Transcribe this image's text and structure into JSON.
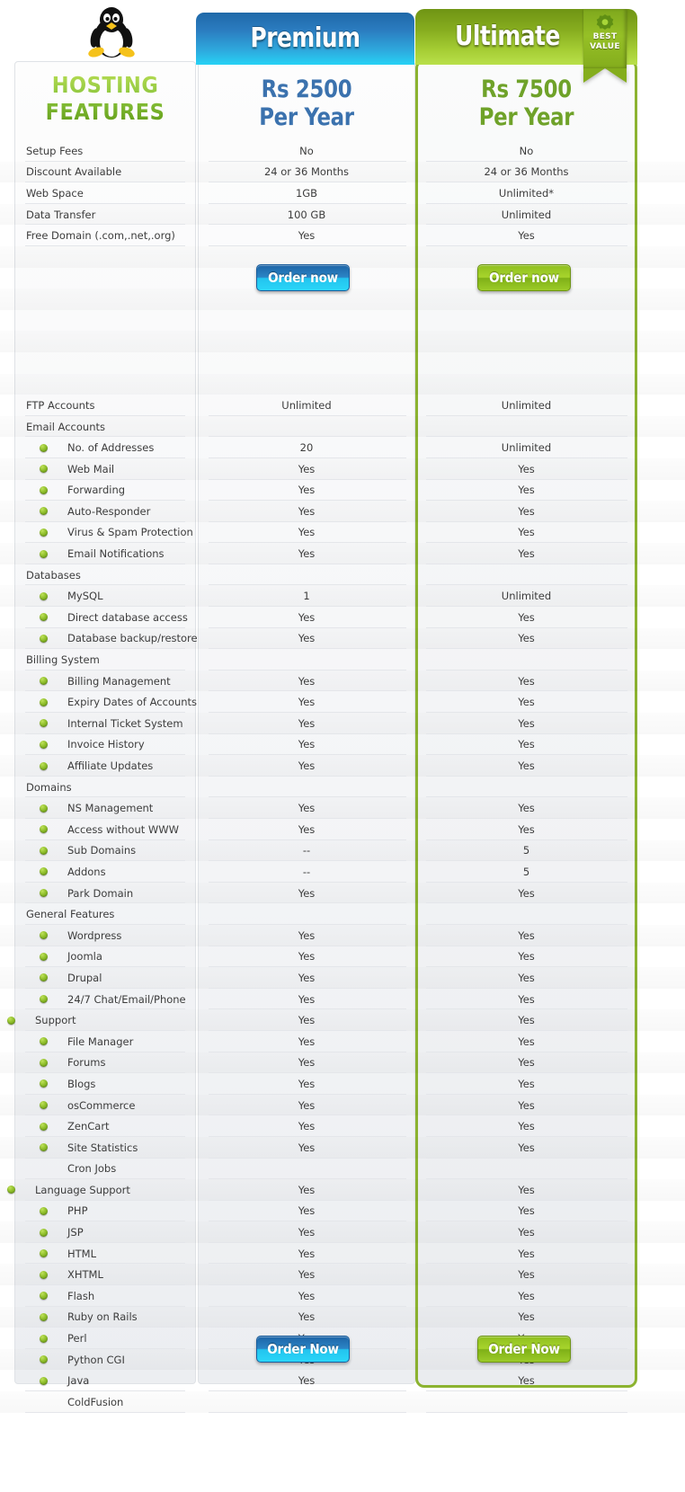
{
  "logo": {
    "name": "linux-tux-logo"
  },
  "features_heading": {
    "line1": "HOSTING",
    "line2": "FEATURES"
  },
  "plans": {
    "premium": {
      "tab_label": "Premium",
      "price_line1": "Rs 2500",
      "price_line2": "Per Year",
      "order_top_label": "Order now",
      "order_bottom_label": "Order Now",
      "accent": "#2b85c6"
    },
    "ultimate": {
      "tab_label": "Ultimate",
      "price_line1": "Rs 7500",
      "price_line2": "Per Year",
      "order_top_label": "Order now",
      "order_bottom_label": "Order Now",
      "accent": "#8cb330",
      "badge_line1": "BEST",
      "badge_line2": "VALUE"
    }
  },
  "rows": [
    {
      "label": "Setup Fees",
      "level": 0,
      "bullet": false,
      "premium": "No",
      "ultimate": "No"
    },
    {
      "label": "Discount Available",
      "level": 0,
      "bullet": false,
      "premium": "24 or 36 Months",
      "ultimate": "24 or 36 Months"
    },
    {
      "label": "Web Space",
      "level": 0,
      "bullet": false,
      "premium": "1GB",
      "ultimate": "Unlimited*"
    },
    {
      "label": "Data Transfer",
      "level": 0,
      "bullet": false,
      "premium": "100 GB",
      "ultimate": "Unlimited"
    },
    {
      "label": "Free Domain (.com,.net,.org)",
      "level": 0,
      "bullet": false,
      "premium": "Yes",
      "ultimate": "Yes"
    },
    {
      "label": "",
      "level": 0,
      "bullet": false,
      "premium": "",
      "ultimate": "",
      "spacer": true
    },
    {
      "label": "",
      "level": 0,
      "bullet": false,
      "premium": "",
      "ultimate": "",
      "spacer": true
    },
    {
      "label": "",
      "level": 0,
      "bullet": false,
      "premium": "",
      "ultimate": "",
      "spacer": true
    },
    {
      "label": "",
      "level": 0,
      "bullet": false,
      "premium": "",
      "ultimate": "",
      "spacer": true
    },
    {
      "label": "",
      "level": 0,
      "bullet": false,
      "premium": "",
      "ultimate": "",
      "spacer": true
    },
    {
      "label": "",
      "level": 0,
      "bullet": false,
      "premium": "",
      "ultimate": "",
      "spacer": true
    },
    {
      "label": "",
      "level": 0,
      "bullet": false,
      "premium": "",
      "ultimate": "",
      "spacer": true
    },
    {
      "label": "FTP Accounts",
      "level": 0,
      "bullet": false,
      "premium": "Unlimited",
      "ultimate": "Unlimited"
    },
    {
      "label": "Email Accounts",
      "level": 0,
      "bullet": false,
      "premium": "",
      "ultimate": ""
    },
    {
      "label": "No. of Addresses",
      "level": 1,
      "bullet": true,
      "premium": "20",
      "ultimate": "Unlimited"
    },
    {
      "label": "Web Mail",
      "level": 1,
      "bullet": true,
      "premium": "Yes",
      "ultimate": "Yes"
    },
    {
      "label": "Forwarding",
      "level": 1,
      "bullet": true,
      "premium": "Yes",
      "ultimate": "Yes"
    },
    {
      "label": "Auto-Responder",
      "level": 1,
      "bullet": true,
      "premium": "Yes",
      "ultimate": "Yes"
    },
    {
      "label": "Virus & Spam Protection",
      "level": 1,
      "bullet": true,
      "premium": "Yes",
      "ultimate": "Yes"
    },
    {
      "label": "Email Notifications",
      "level": 1,
      "bullet": true,
      "premium": "Yes",
      "ultimate": "Yes"
    },
    {
      "label": "Databases",
      "level": 0,
      "bullet": false,
      "premium": "",
      "ultimate": ""
    },
    {
      "label": "MySQL",
      "level": 1,
      "bullet": true,
      "premium": "1",
      "ultimate": "Unlimited"
    },
    {
      "label": "Direct database access",
      "level": 1,
      "bullet": true,
      "premium": "Yes",
      "ultimate": "Yes"
    },
    {
      "label": "Database backup/restore",
      "level": 1,
      "bullet": true,
      "premium": "Yes",
      "ultimate": "Yes"
    },
    {
      "label": "Billing System",
      "level": 0,
      "bullet": false,
      "premium": "",
      "ultimate": ""
    },
    {
      "label": "Billing Management",
      "level": 1,
      "bullet": true,
      "premium": "Yes",
      "ultimate": "Yes"
    },
    {
      "label": "Expiry Dates of Accounts",
      "level": 1,
      "bullet": true,
      "premium": "Yes",
      "ultimate": "Yes"
    },
    {
      "label": "Internal Ticket System",
      "level": 1,
      "bullet": true,
      "premium": "Yes",
      "ultimate": "Yes"
    },
    {
      "label": "Invoice History",
      "level": 1,
      "bullet": true,
      "premium": "Yes",
      "ultimate": "Yes"
    },
    {
      "label": "Affiliate Updates",
      "level": 1,
      "bullet": true,
      "premium": "Yes",
      "ultimate": "Yes"
    },
    {
      "label": "Domains",
      "level": 0,
      "bullet": false,
      "premium": "",
      "ultimate": ""
    },
    {
      "label": "NS Management",
      "level": 1,
      "bullet": true,
      "premium": "Yes",
      "ultimate": "Yes"
    },
    {
      "label": "Access without WWW",
      "level": 1,
      "bullet": true,
      "premium": "Yes",
      "ultimate": "Yes"
    },
    {
      "label": "Sub Domains",
      "level": 1,
      "bullet": true,
      "premium": "--",
      "ultimate": "5"
    },
    {
      "label": "Addons",
      "level": 1,
      "bullet": true,
      "premium": "--",
      "ultimate": "5"
    },
    {
      "label": "Park Domain",
      "level": 1,
      "bullet": true,
      "premium": "Yes",
      "ultimate": "Yes"
    },
    {
      "label": "General Features",
      "level": 0,
      "bullet": false,
      "premium": "",
      "ultimate": ""
    },
    {
      "label": "Wordpress",
      "level": 1,
      "bullet": true,
      "premium": "Yes",
      "ultimate": "Yes"
    },
    {
      "label": "Joomla",
      "level": 1,
      "bullet": true,
      "premium": "Yes",
      "ultimate": "Yes"
    },
    {
      "label": "Drupal",
      "level": 1,
      "bullet": true,
      "premium": "Yes",
      "ultimate": "Yes"
    },
    {
      "label": "24/7 Chat/Email/Phone",
      "level": 1,
      "bullet": true,
      "premium": "Yes",
      "ultimate": "Yes"
    },
    {
      "label": "Support",
      "level": 0,
      "bullet": true,
      "bleed": true,
      "premium": "Yes",
      "ultimate": "Yes"
    },
    {
      "label": "File Manager",
      "level": 1,
      "bullet": true,
      "premium": "Yes",
      "ultimate": "Yes"
    },
    {
      "label": "Forums",
      "level": 1,
      "bullet": true,
      "premium": "Yes",
      "ultimate": "Yes"
    },
    {
      "label": "Blogs",
      "level": 1,
      "bullet": true,
      "premium": "Yes",
      "ultimate": "Yes"
    },
    {
      "label": "osCommerce",
      "level": 1,
      "bullet": true,
      "premium": "Yes",
      "ultimate": "Yes"
    },
    {
      "label": "ZenCart",
      "level": 1,
      "bullet": true,
      "premium": "Yes",
      "ultimate": "Yes"
    },
    {
      "label": "Site Statistics",
      "level": 1,
      "bullet": true,
      "premium": "Yes",
      "ultimate": "Yes"
    },
    {
      "label": "Cron Jobs",
      "level": 1,
      "bullet": false,
      "premium": "",
      "ultimate": ""
    },
    {
      "label": "Language Support",
      "level": 0,
      "bullet": true,
      "bleed": true,
      "premium": "Yes",
      "ultimate": "Yes"
    },
    {
      "label": "PHP",
      "level": 1,
      "bullet": true,
      "premium": "Yes",
      "ultimate": "Yes"
    },
    {
      "label": "JSP",
      "level": 1,
      "bullet": true,
      "premium": "Yes",
      "ultimate": "Yes"
    },
    {
      "label": "HTML",
      "level": 1,
      "bullet": true,
      "premium": "Yes",
      "ultimate": "Yes"
    },
    {
      "label": "XHTML",
      "level": 1,
      "bullet": true,
      "premium": "Yes",
      "ultimate": "Yes"
    },
    {
      "label": "Flash",
      "level": 1,
      "bullet": true,
      "premium": "Yes",
      "ultimate": "Yes"
    },
    {
      "label": "Ruby on Rails",
      "level": 1,
      "bullet": true,
      "premium": "Yes",
      "ultimate": "Yes"
    },
    {
      "label": "Perl",
      "level": 1,
      "bullet": true,
      "premium": "Yes",
      "ultimate": "Yes"
    },
    {
      "label": "Python CGI",
      "level": 1,
      "bullet": true,
      "premium": "Yes",
      "ultimate": "Yes"
    },
    {
      "label": "Java",
      "level": 1,
      "bullet": true,
      "premium": "Yes",
      "ultimate": "Yes"
    },
    {
      "label": "ColdFusion",
      "level": 1,
      "bullet": false,
      "premium": "",
      "ultimate": ""
    }
  ]
}
